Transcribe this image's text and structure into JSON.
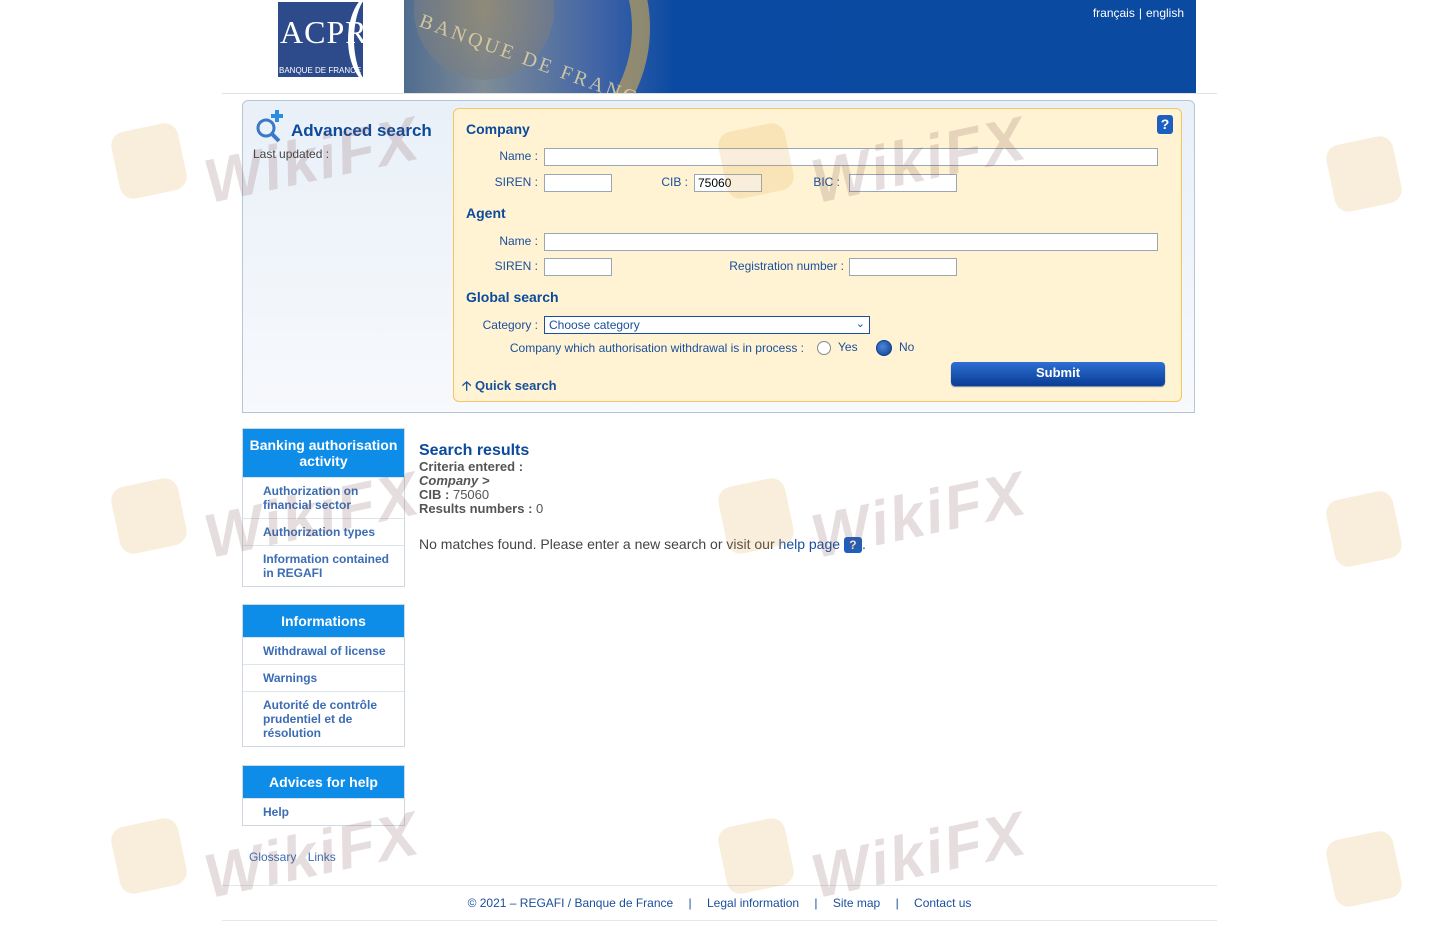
{
  "header": {
    "logo_text": "ACPR",
    "logo_subtext": "BANQUE DE FRANCE",
    "banner_text": "BANQUE DE FRANCE",
    "lang_fr": "français",
    "lang_sep": "|",
    "lang_en": "english"
  },
  "advanced": {
    "title": "Advanced search",
    "last_updated": "Last updated :",
    "help_icon": "?",
    "company": {
      "title": "Company",
      "name_label": "Name :",
      "name_value": "",
      "siren_label": "SIREN :",
      "siren_value": "",
      "cib_label": "CIB :",
      "cib_value": "75060",
      "bic_label": "BIC :",
      "bic_value": ""
    },
    "agent": {
      "title": "Agent",
      "name_label": "Name :",
      "name_value": "",
      "siren_label": "SIREN :",
      "siren_value": "",
      "reg_label": "Registration number :",
      "reg_value": ""
    },
    "global": {
      "title": "Global search",
      "category_label": "Category :",
      "category_value": "Choose category",
      "withdrawal_label": "Company which authorisation withdrawal is in process :",
      "yes": "Yes",
      "no": "No",
      "selected": "No"
    },
    "submit": "Submit",
    "quick_search": "Quick search"
  },
  "nav": {
    "banking": {
      "title": "Banking authorisation activity",
      "items": [
        "Authorization on financial sector",
        "Authorization types",
        "Information contained in REGAFI"
      ]
    },
    "informations": {
      "title": "Informations",
      "items": [
        "Withdrawal of license",
        "Warnings",
        "Autorité de contrôle prudentiel et de résolution"
      ]
    },
    "help": {
      "title": "Advices for help",
      "items": [
        "Help"
      ]
    },
    "bottom_links": [
      "Glossary",
      "Links"
    ]
  },
  "results": {
    "title": "Search results",
    "criteria_label": "Criteria entered :",
    "company_line": "Company >",
    "cib_label": "CIB :",
    "cib_value": "75060",
    "numbers_label": "Results numbers :",
    "numbers_value": "0",
    "no_match_text": "No matches found. Please enter a new search or visit our",
    "help_link": "help page",
    "help_icon": "?",
    "trailing": "."
  },
  "footer": {
    "copyright": "© 2021 – REGAFI / Banque de France",
    "legal": "Legal information",
    "sitemap": "Site map",
    "contact": "Contact us",
    "sep": "|"
  },
  "watermark": "WikiFX",
  "colors": {
    "primary": "#0b4a9c",
    "nav_head": "#0d8ce8",
    "form_bg": "#fff3d3",
    "banner": "#0a4aa0"
  }
}
